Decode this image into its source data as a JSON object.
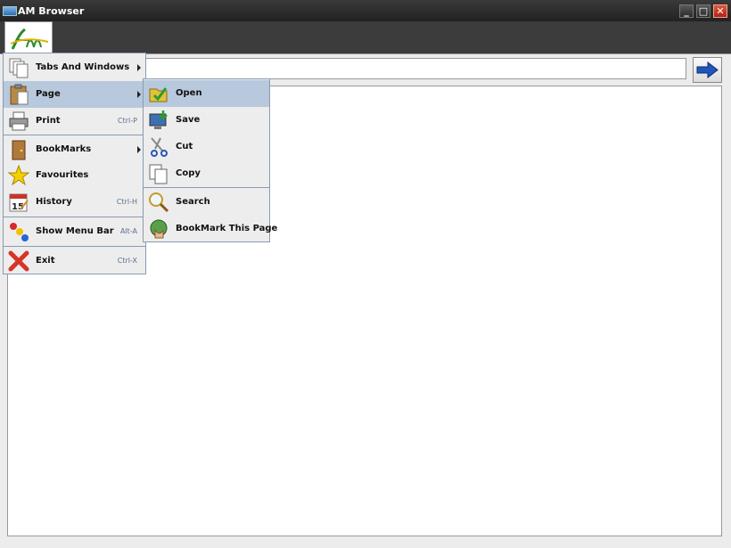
{
  "window": {
    "title": "AM Browser"
  },
  "toolbar": {
    "logo_text": "Am"
  },
  "address": {
    "value": ""
  },
  "main_menu": {
    "items": [
      {
        "label": "Tabs And Windows",
        "icon": "pages-icon"
      },
      {
        "label": "Page",
        "icon": "clipboard-icon"
      },
      {
        "label": "Print",
        "accel": "Ctrl-P",
        "icon": "printer-icon"
      },
      {
        "label": "BookMarks",
        "icon": "door-icon"
      },
      {
        "label": "Favourites",
        "icon": "star-icon"
      },
      {
        "label": "History",
        "accel": "Ctrl-H",
        "icon": "calendar-icon",
        "calendar_day": "15"
      },
      {
        "label": "Show Menu Bar",
        "accel": "Alt-A",
        "icon": "dots-icon"
      },
      {
        "label": "Exit",
        "accel": "Ctrl-X",
        "icon": "close-x-icon"
      }
    ]
  },
  "page_submenu": {
    "items": [
      {
        "label": "Open",
        "icon": "folder-check-icon"
      },
      {
        "label": "Save",
        "icon": "save-monitor-icon"
      },
      {
        "label": "Cut",
        "icon": "scissors-icon"
      },
      {
        "label": "Copy",
        "icon": "copy-icon"
      },
      {
        "label": "Search",
        "icon": "magnifier-icon"
      },
      {
        "label": "BookMark This Page",
        "icon": "bookmark-globe-icon"
      }
    ]
  },
  "colors": {
    "menu_highlight": "#b8c8dd",
    "accelerator": "#5c6f8c",
    "go_arrow": "#1f56b8"
  }
}
